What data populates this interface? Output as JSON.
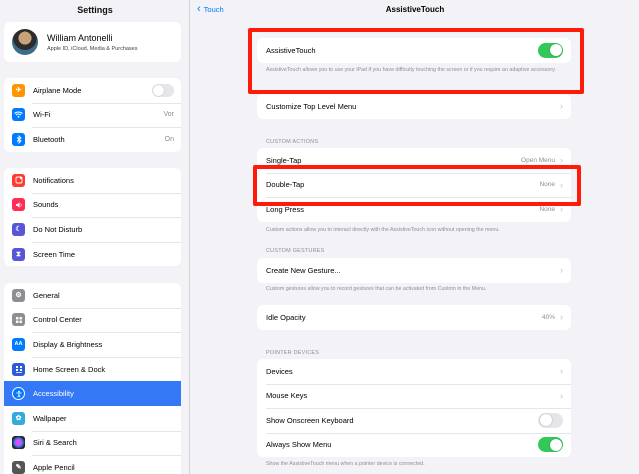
{
  "sidebar": {
    "title": "Settings",
    "profile": {
      "name": "William Antonelli",
      "subtitle": "Apple ID, iCloud, Media & Purchases"
    },
    "groups": [
      [
        {
          "label": "Airplane Mode",
          "icon": "airplane-icon",
          "color": "#ff9500",
          "toggle": "off"
        },
        {
          "label": "Wi-Fi",
          "icon": "wifi-icon",
          "color": "#007aff",
          "value": "Vor"
        },
        {
          "label": "Bluetooth",
          "icon": "bluetooth-icon",
          "color": "#007aff",
          "value": "On"
        }
      ],
      [
        {
          "label": "Notifications",
          "icon": "notifications-icon",
          "color": "#ff3b30"
        },
        {
          "label": "Sounds",
          "icon": "sounds-icon",
          "color": "#ff2d55"
        },
        {
          "label": "Do Not Disturb",
          "icon": "moon-icon",
          "color": "#5856d6"
        },
        {
          "label": "Screen Time",
          "icon": "hourglass-icon",
          "color": "#5856d6"
        }
      ],
      [
        {
          "label": "General",
          "icon": "gear-icon",
          "color": "#8e8e93"
        },
        {
          "label": "Control Center",
          "icon": "control-center-icon",
          "color": "#8e8e93"
        },
        {
          "label": "Display & Brightness",
          "icon": "display-icon",
          "color": "#007aff",
          "glyph": "AA"
        },
        {
          "label": "Home Screen & Dock",
          "icon": "home-screen-icon",
          "color": "#2c5bd9"
        },
        {
          "label": "Accessibility",
          "icon": "accessibility-icon",
          "color": "#007aff",
          "selected": true
        },
        {
          "label": "Wallpaper",
          "icon": "wallpaper-icon",
          "color": "#34aadc"
        },
        {
          "label": "Siri & Search",
          "icon": "siri-icon",
          "color": "#222222"
        },
        {
          "label": "Apple Pencil",
          "icon": "pencil-icon",
          "color": "#555555"
        }
      ]
    ]
  },
  "nav": {
    "back_label": "Touch",
    "title": "AssistiveTouch"
  },
  "main": {
    "assistive_touch": {
      "label": "AssistiveTouch",
      "toggle": "on",
      "footer": "AssistiveTouch allows you to use your iPad if you have difficulty touching the screen or if you require an adaptive accessory."
    },
    "customize_menu": {
      "label": "Customize Top Level Menu"
    },
    "custom_actions": {
      "header": "CUSTOM ACTIONS",
      "rows": [
        {
          "label": "Single-Tap",
          "value": "Open Menu"
        },
        {
          "label": "Double-Tap",
          "value": "None"
        },
        {
          "label": "Long Press",
          "value": "None"
        }
      ],
      "footer": "Custom actions allow you to interact directly with the AssistiveTouch icon without opening the menu."
    },
    "custom_gestures": {
      "header": "CUSTOM GESTURES",
      "rows": [
        {
          "label": "Create New Gesture..."
        }
      ],
      "footer": "Custom gestures allow you to record gestures that can be activated from Custom in the Menu."
    },
    "idle_opacity": {
      "label": "Idle Opacity",
      "value": "40%"
    },
    "pointer_devices": {
      "header": "POINTER DEVICES",
      "rows": [
        {
          "label": "Devices"
        },
        {
          "label": "Mouse Keys"
        },
        {
          "label": "Show Onscreen Keyboard",
          "toggle": "off"
        },
        {
          "label": "Always Show Menu",
          "toggle": "on"
        }
      ],
      "footer": "Show the AssistiveTouch menu when a pointer device is connected."
    }
  },
  "colors": {
    "accent": "#007aff",
    "selected_row": "#3478f6",
    "toggle_on": "#34c759",
    "highlight_box": "#ff1a0a"
  }
}
